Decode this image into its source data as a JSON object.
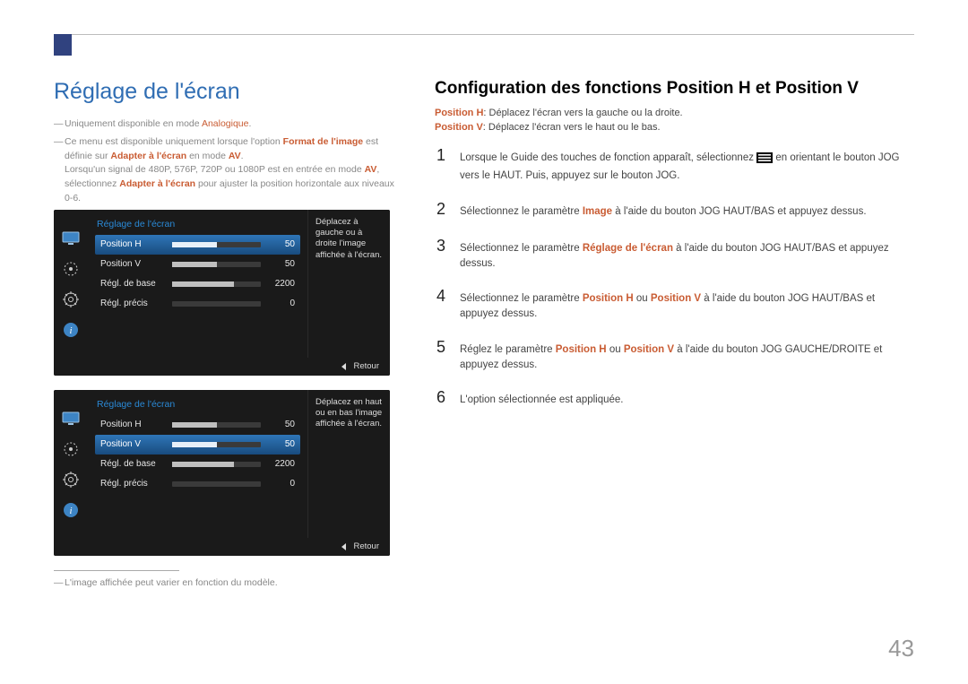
{
  "page": {
    "number": "43"
  },
  "left": {
    "title": "Réglage de l'écran",
    "note1_a": "Uniquement disponible en mode ",
    "note1_b": "Analogique",
    "note1_c": ".",
    "note2_a": "Ce menu est disponible uniquement lorsque l'option ",
    "note2_b": "Format de l'image",
    "note2_c": " est définie sur ",
    "note2_d": "Adapter à l'écran",
    "note2_e": " en mode ",
    "note2_f": "AV",
    "note2_g": ".",
    "note2_h": "Lorsqu'un signal de 480P, 576P, 720P ou 1080P est en entrée en mode ",
    "note2_i": "AV",
    "note2_j": ", sélectionnez ",
    "note2_k": "Adapter à l'écran",
    "note2_l": " pour ajuster la position horizontale aux niveaux 0-6.",
    "footnote": "L'image affichée peut varier en fonction du modèle."
  },
  "osd": {
    "title": "Réglage de l'écran",
    "row1": {
      "label": "Position H",
      "value": "50",
      "fill": "50%"
    },
    "row2": {
      "label": "Position V",
      "value": "50",
      "fill": "50%"
    },
    "row3": {
      "label": "Régl. de base",
      "value": "2200",
      "fill": "70%"
    },
    "row4": {
      "label": "Régl. précis",
      "value": "0",
      "fill": "0%"
    },
    "desc1": "Déplacez à gauche ou à droite l'image affichée à l'écran.",
    "desc2": "Déplacez en haut ou en bas l'image affichée à l'écran.",
    "back": "Retour"
  },
  "right": {
    "title": "Configuration des fonctions Position H et Position V",
    "def1_term": "Position H",
    "def1_text": ": Déplacez l'écran vers la gauche ou la droite.",
    "def2_term": "Position V",
    "def2_text": ": Déplacez l'écran vers le haut ou le bas.",
    "step1_a": "Lorsque le Guide des touches de fonction apparaît, sélectionnez ",
    "step1_b": " en orientant le bouton JOG vers le HAUT. Puis, appuyez sur le bouton JOG.",
    "step2_a": "Sélectionnez le paramètre ",
    "step2_b": "Image",
    "step2_c": " à l'aide du bouton JOG HAUT/BAS et appuyez dessus.",
    "step3_a": "Sélectionnez le paramètre ",
    "step3_b": "Réglage de l'écran",
    "step3_c": " à l'aide du bouton JOG HAUT/BAS et appuyez dessus.",
    "step4_a": "Sélectionnez le paramètre ",
    "step4_b": "Position H",
    "step4_c": " ou ",
    "step4_d": "Position V",
    "step4_e": " à l'aide du bouton JOG HAUT/BAS et appuyez dessus.",
    "step5_a": "Réglez le paramètre ",
    "step5_b": "Position H",
    "step5_c": " ou ",
    "step5_d": "Position V",
    "step5_e": " à l'aide du bouton JOG GAUCHE/DROITE et appuyez dessus.",
    "step6": "L'option sélectionnée est appliquée."
  },
  "nums": {
    "s1": "1",
    "s2": "2",
    "s3": "3",
    "s4": "4",
    "s5": "5",
    "s6": "6"
  }
}
